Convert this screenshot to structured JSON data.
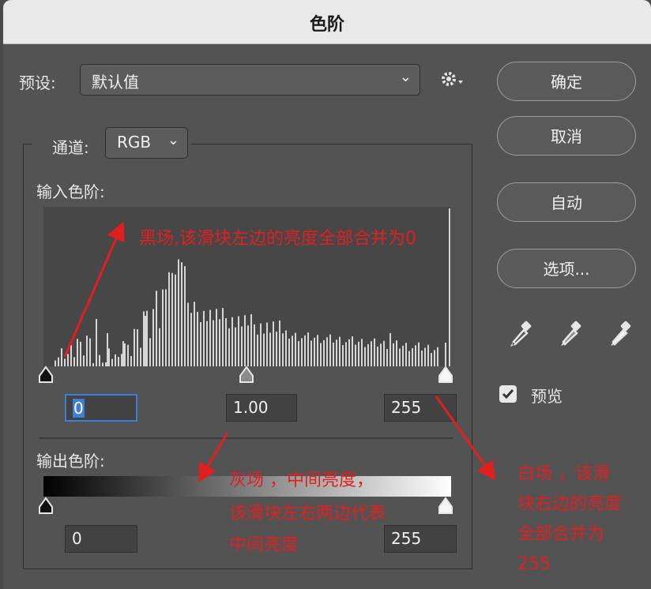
{
  "dialog": {
    "title": "色阶"
  },
  "preset": {
    "label": "预设:",
    "value": "默认值"
  },
  "channel": {
    "label": "通道:",
    "value": "RGB"
  },
  "input_levels": {
    "label": "输入色阶:",
    "black": "0",
    "gamma": "1.00",
    "white": "255"
  },
  "output_levels": {
    "label": "输出色阶:",
    "black": "0",
    "white": "255"
  },
  "buttons": {
    "ok": "确定",
    "cancel": "取消",
    "auto": "自动",
    "options": "选项..."
  },
  "preview": {
    "label": "预览",
    "checked": true
  },
  "annotations": {
    "black_point": "黑场,该滑块左边的亮度全部合并为0",
    "gray_line1": "灰场 ，中间亮度，",
    "gray_line2": "该滑块左右两边代表",
    "gray_line3": "中间亮度",
    "white_line1": "白场 ，该滑",
    "white_line2": "块右边的亮度",
    "white_line3": "全部合并为",
    "white_line4": "255"
  },
  "colors": {
    "annotation": "#e02020",
    "panel": "#535353",
    "accent_focus": "#3d7fd6"
  },
  "icons": [
    "gear-icon",
    "chevron-down-icon",
    "black-eyedropper-icon",
    "gray-eyedropper-icon",
    "white-eyedropper-icon",
    "checkmark-icon"
  ]
}
